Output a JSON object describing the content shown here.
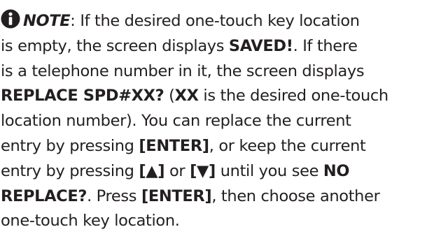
{
  "icon": "info-icon",
  "note": {
    "label": "NOTE",
    "line1": ": If the desired one-touch key location",
    "line2": "is empty, the screen displays ",
    "saved": "SAVED!",
    "line2_end": ". If there",
    "line3": "is a telephone number in it, the screen displays",
    "replace_prompt": "REPLACE SPD#XX?",
    "line4_mid": " (",
    "xx": "XX",
    "line4_end": " is the desired one-touch",
    "line5": "location number). You can replace the current",
    "line6_start": "entry by pressing ",
    "enter_key": "[ENTER]",
    "line6_end": ", or keep the current",
    "line7_start": "entry by pressing ",
    "up_key": "[▲]",
    "line7_or": " or ",
    "down_key": "[▼]",
    "line7_mid": " until you see ",
    "no": "NO",
    "replace_word": "REPLACE?",
    "line8_mid": ". Press ",
    "line8_end": ", then choose another",
    "line9": "one-touch key location."
  }
}
